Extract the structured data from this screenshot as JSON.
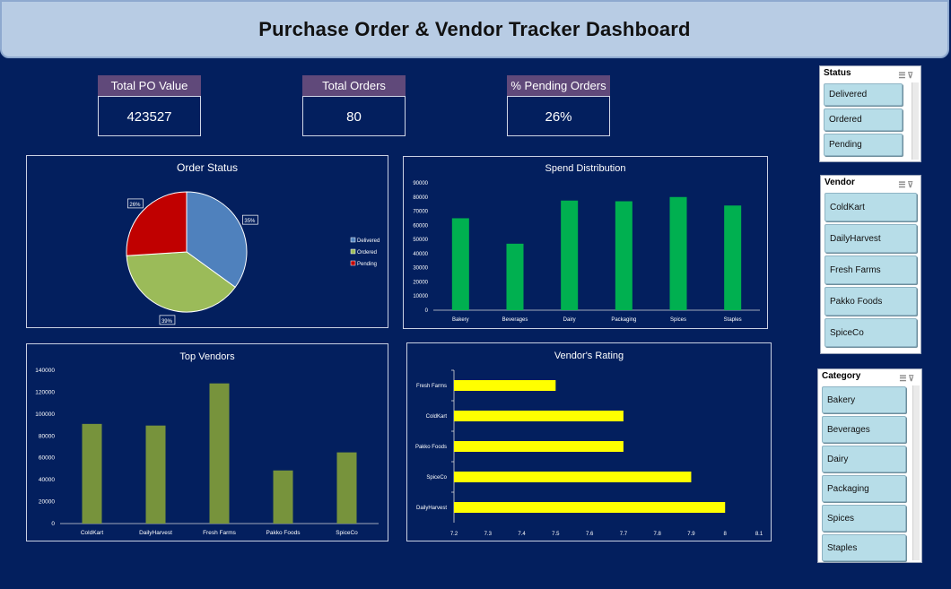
{
  "header": {
    "title": "Purchase Order & Vendor Tracker Dashboard"
  },
  "kpis": [
    {
      "label": "Total PO Value",
      "value": "423527"
    },
    {
      "label": "Total Orders",
      "value": "80"
    },
    {
      "label": "% Pending Orders",
      "value": "26%"
    }
  ],
  "slicers": {
    "status": {
      "title": "Status",
      "items": [
        "Delivered",
        "Ordered",
        "Pending"
      ]
    },
    "vendor": {
      "title": "Vendor",
      "items": [
        "ColdKart",
        "DailyHarvest",
        "Fresh Farms",
        "Pakko Foods",
        "SpiceCo"
      ]
    },
    "category": {
      "title": "Category",
      "items": [
        "Bakery",
        "Beverages",
        "Dairy",
        "Packaging",
        "Spices",
        "Staples"
      ]
    }
  },
  "chart_data": [
    {
      "id": "order_status",
      "type": "pie",
      "title": "Order Status",
      "labels": [
        "Delivered",
        "Ordered",
        "Pending"
      ],
      "values": [
        35,
        39,
        26
      ],
      "data_labels": [
        "35%",
        "39%",
        "26%"
      ],
      "colors": [
        "#4f81bd",
        "#9bbb59",
        "#c00000"
      ],
      "legend": "right"
    },
    {
      "id": "spend_distribution",
      "type": "bar",
      "title": "Spend Distribution",
      "categories": [
        "Bakery",
        "Beverages",
        "Dairy",
        "Packaging",
        "Spices",
        "Staples"
      ],
      "values": [
        65000,
        47000,
        77500,
        77000,
        80000,
        74000
      ],
      "ylim": [
        0,
        90000
      ],
      "yticks": [
        "0",
        "10000",
        "20000",
        "30000",
        "40000",
        "50000",
        "60000",
        "70000",
        "80000",
        "90000"
      ],
      "color": "#00b050"
    },
    {
      "id": "top_vendors",
      "type": "bar",
      "title": "Top Vendors",
      "categories": [
        "ColdKart",
        "DailyHarvest",
        "Fresh Farms",
        "Pakko Foods",
        "SpiceCo"
      ],
      "values": [
        91000,
        89500,
        128000,
        48500,
        65000
      ],
      "ylim": [
        0,
        140000
      ],
      "yticks": [
        "0",
        "20000",
        "40000",
        "60000",
        "80000",
        "100000",
        "120000",
        "140000"
      ],
      "color": "#77933c"
    },
    {
      "id": "vendor_rating",
      "type": "bar",
      "orientation": "horizontal",
      "title": "Vendor's Rating",
      "categories": [
        "Fresh Farms",
        "ColdKart",
        "Pakko Foods",
        "SpiceCo",
        "DailyHarvest"
      ],
      "values": [
        7.5,
        7.7,
        7.7,
        7.9,
        8.0
      ],
      "xlim": [
        7.2,
        8.1
      ],
      "xticks": [
        "7.2",
        "7.3",
        "7.4",
        "7.5",
        "7.6",
        "7.7",
        "7.8",
        "7.9",
        "8",
        "8.1"
      ],
      "color": "#ffff00"
    }
  ]
}
